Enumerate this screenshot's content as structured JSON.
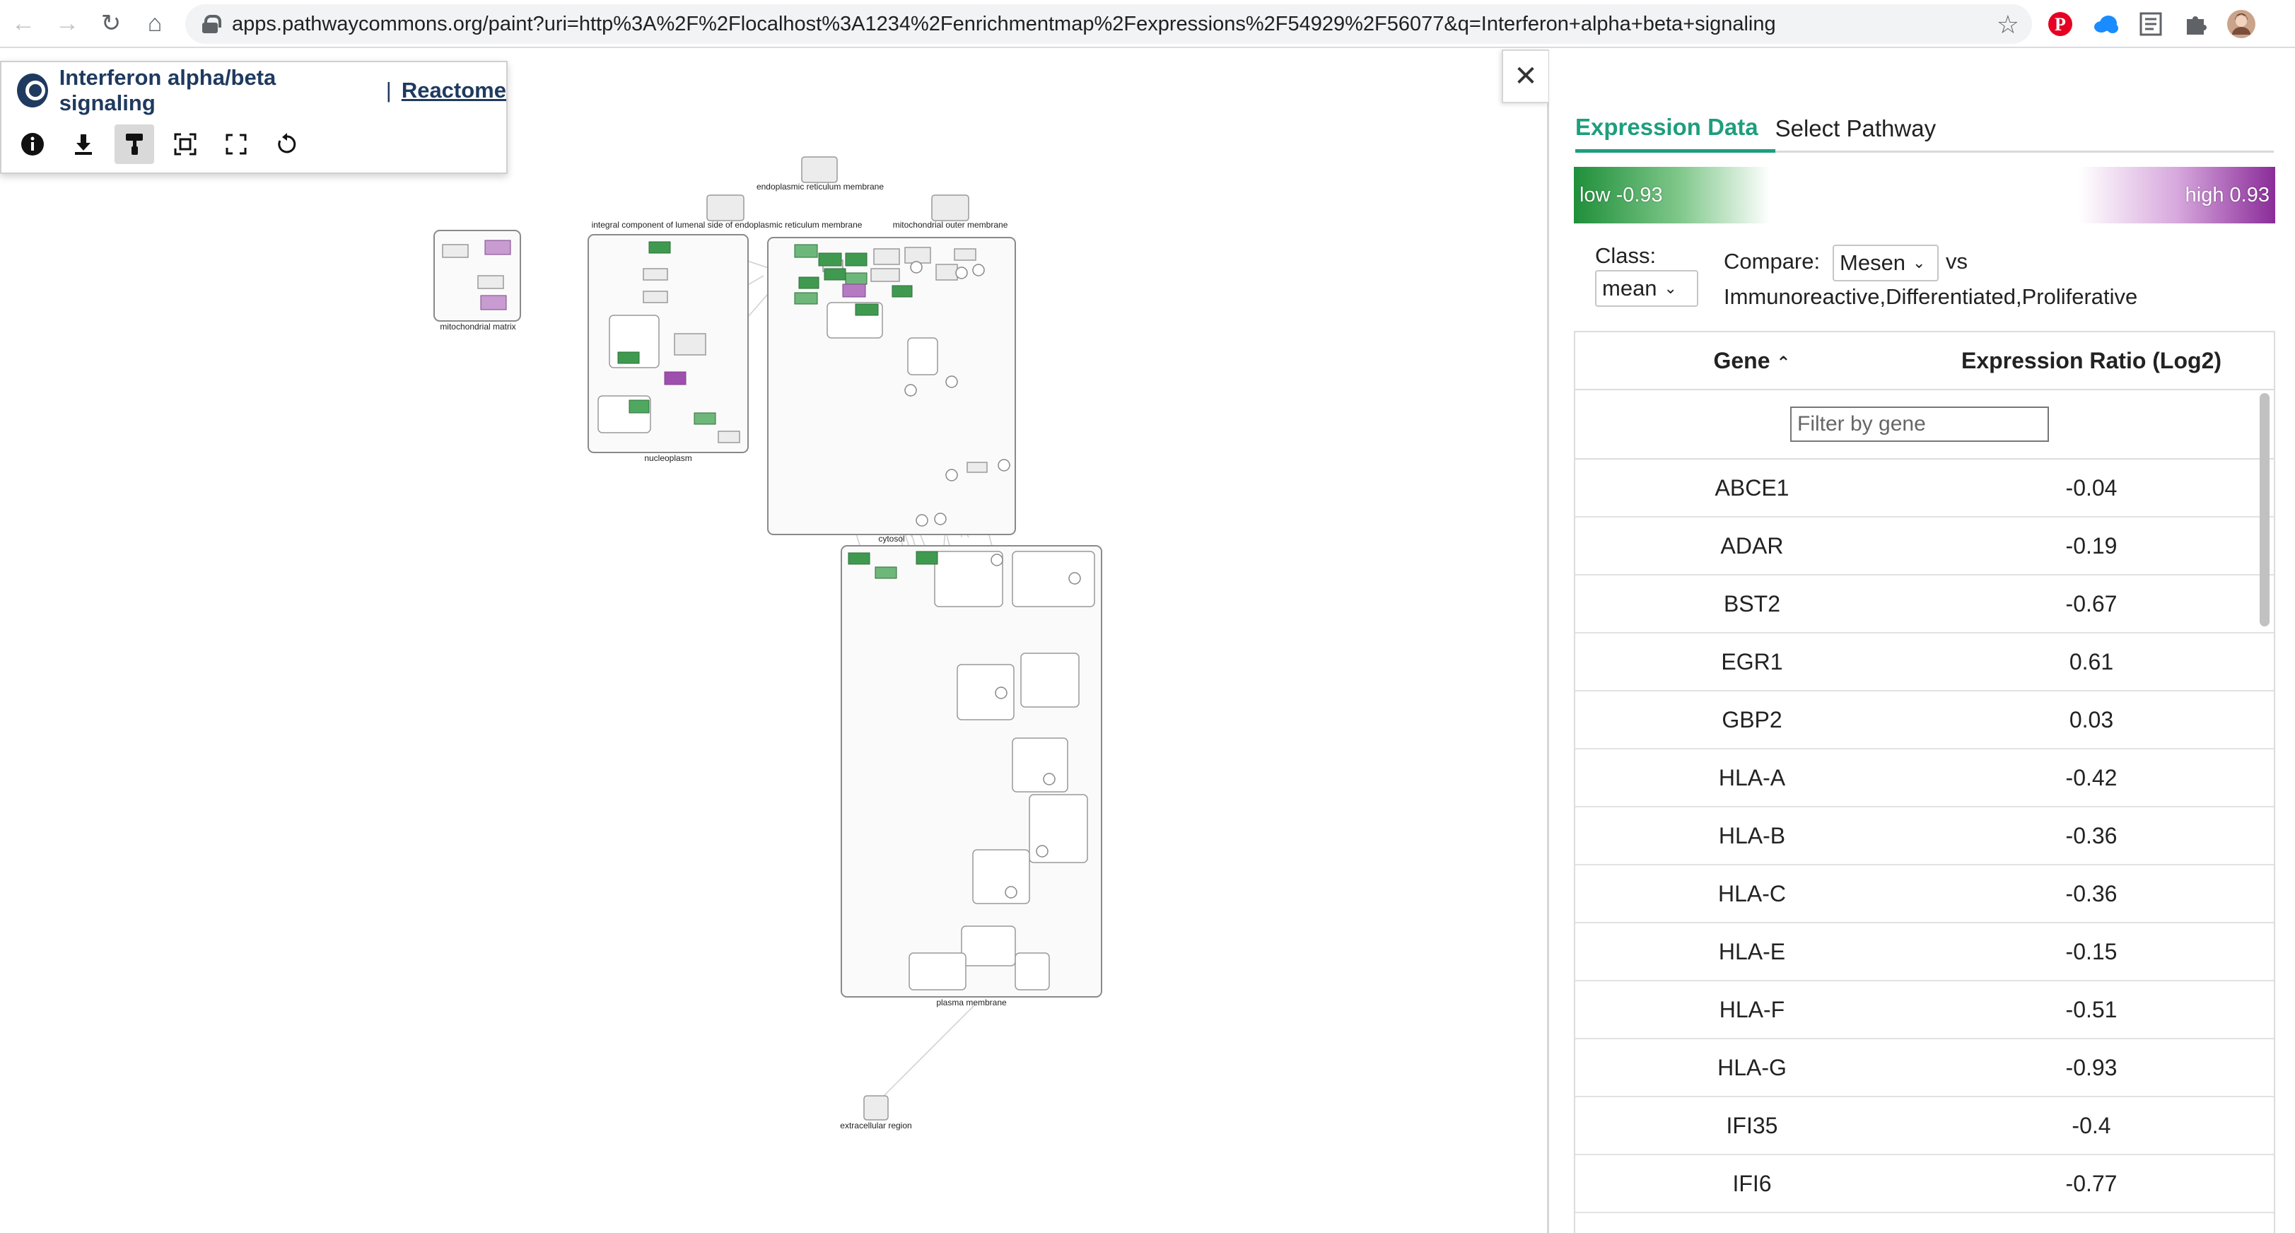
{
  "browser": {
    "url": "apps.pathwaycommons.org/paint?uri=http%3A%2F%2Flocalhost%3A1234%2Fenrichmentmap%2Fexpressions%2F54929%2F56077&q=Interferon+alpha+beta+signaling",
    "nav": {
      "back": "←",
      "forward": "→",
      "reload": "↻",
      "home": "⌂"
    },
    "star": "☆",
    "extensions": [
      "pinterest-icon",
      "cloud-icon",
      "reader-icon",
      "puzzle-icon",
      "avatar"
    ]
  },
  "title_panel": {
    "title": "Interferon alpha/beta signaling",
    "separator": "|",
    "source": "Reactome",
    "tools": [
      "info-icon",
      "download-icon",
      "paint-icon",
      "fit-icon",
      "fullscreen-icon",
      "reset-icon"
    ]
  },
  "diagram": {
    "compartments": [
      "endoplasmic reticulum membrane",
      "integral component of lumenal side of endoplasmic reticulum membrane",
      "mitochondrial outer membrane",
      "mitochondrial matrix",
      "nucleoplasm",
      "cytosol",
      "plasma membrane",
      "extracellular region"
    ]
  },
  "sidepanel": {
    "close": "✕",
    "tabs": [
      {
        "label": "Expression Data",
        "active": true
      },
      {
        "label": "Select Pathway",
        "active": false
      }
    ],
    "legend": {
      "low": "low -0.93",
      "high": "high 0.93",
      "low_color": "#1f8f3a",
      "high_color": "#8a2c99"
    },
    "class_label": "Class:",
    "class_value": "mean",
    "compare_label": "Compare:",
    "compare_value": "Mesen",
    "vs": "vs",
    "compare_rest": "Immunoreactive,Differentiated,Proliferative",
    "table": {
      "headers": {
        "gene": "Gene",
        "sort": "⌃",
        "expression": "Expression Ratio (Log2)"
      },
      "filter_placeholder": "Filter by gene",
      "rows": [
        {
          "gene": "ABCE1",
          "value": "-0.04"
        },
        {
          "gene": "ADAR",
          "value": "-0.19"
        },
        {
          "gene": "BST2",
          "value": "-0.67"
        },
        {
          "gene": "EGR1",
          "value": "0.61"
        },
        {
          "gene": "GBP2",
          "value": "0.03"
        },
        {
          "gene": "HLA-A",
          "value": "-0.42"
        },
        {
          "gene": "HLA-B",
          "value": "-0.36"
        },
        {
          "gene": "HLA-C",
          "value": "-0.36"
        },
        {
          "gene": "HLA-E",
          "value": "-0.15"
        },
        {
          "gene": "HLA-F",
          "value": "-0.51"
        },
        {
          "gene": "HLA-G",
          "value": "-0.93"
        },
        {
          "gene": "IFI35",
          "value": "-0.4"
        },
        {
          "gene": "IFI6",
          "value": "-0.77"
        }
      ]
    }
  }
}
